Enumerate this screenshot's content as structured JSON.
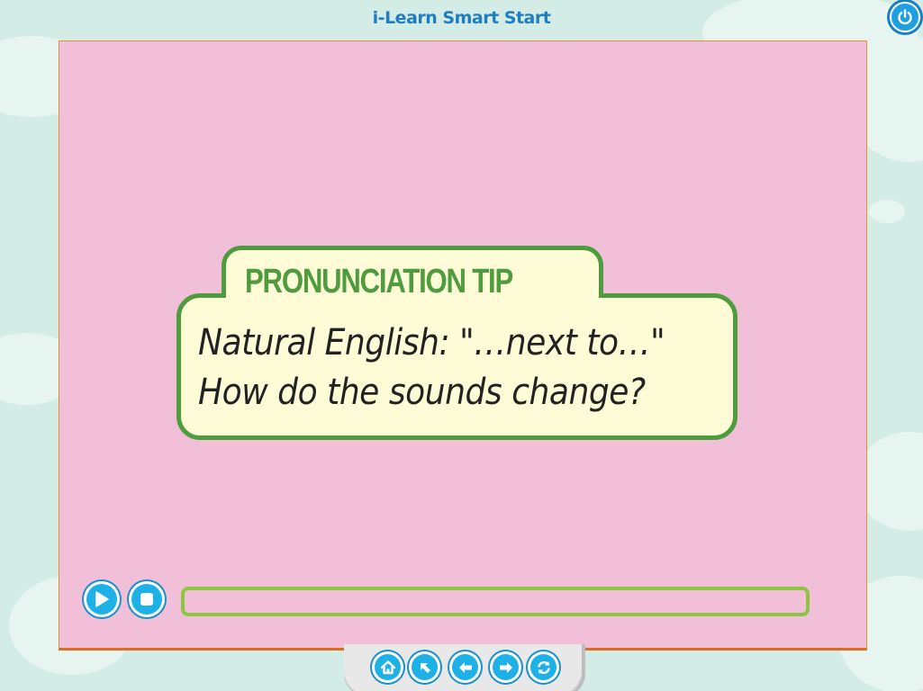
{
  "app": {
    "title": "i-Learn Smart Start"
  },
  "header": {
    "power_icon": "power-icon"
  },
  "tip": {
    "heading": "PRONUNCIATION TIP",
    "line1": "Natural English: \"…next to…\"",
    "line2": "How do the sounds change?"
  },
  "player": {
    "play_icon": "play-icon",
    "stop_icon": "stop-icon",
    "progress": 0
  },
  "nav": {
    "items": [
      {
        "icon": "home-icon"
      },
      {
        "icon": "arrow-up-left-icon"
      },
      {
        "icon": "arrow-left-icon"
      },
      {
        "icon": "arrow-right-icon"
      },
      {
        "icon": "replay-icon"
      }
    ]
  },
  "colors": {
    "background": "#d3ece6",
    "content_bg": "#f1bfd8",
    "tip_border": "#4e9c3d",
    "tip_fill": "#fefbd7",
    "progress_border": "#8cc63e",
    "button_blue": "#1eb1e8",
    "title_blue": "#1f7ec1"
  }
}
